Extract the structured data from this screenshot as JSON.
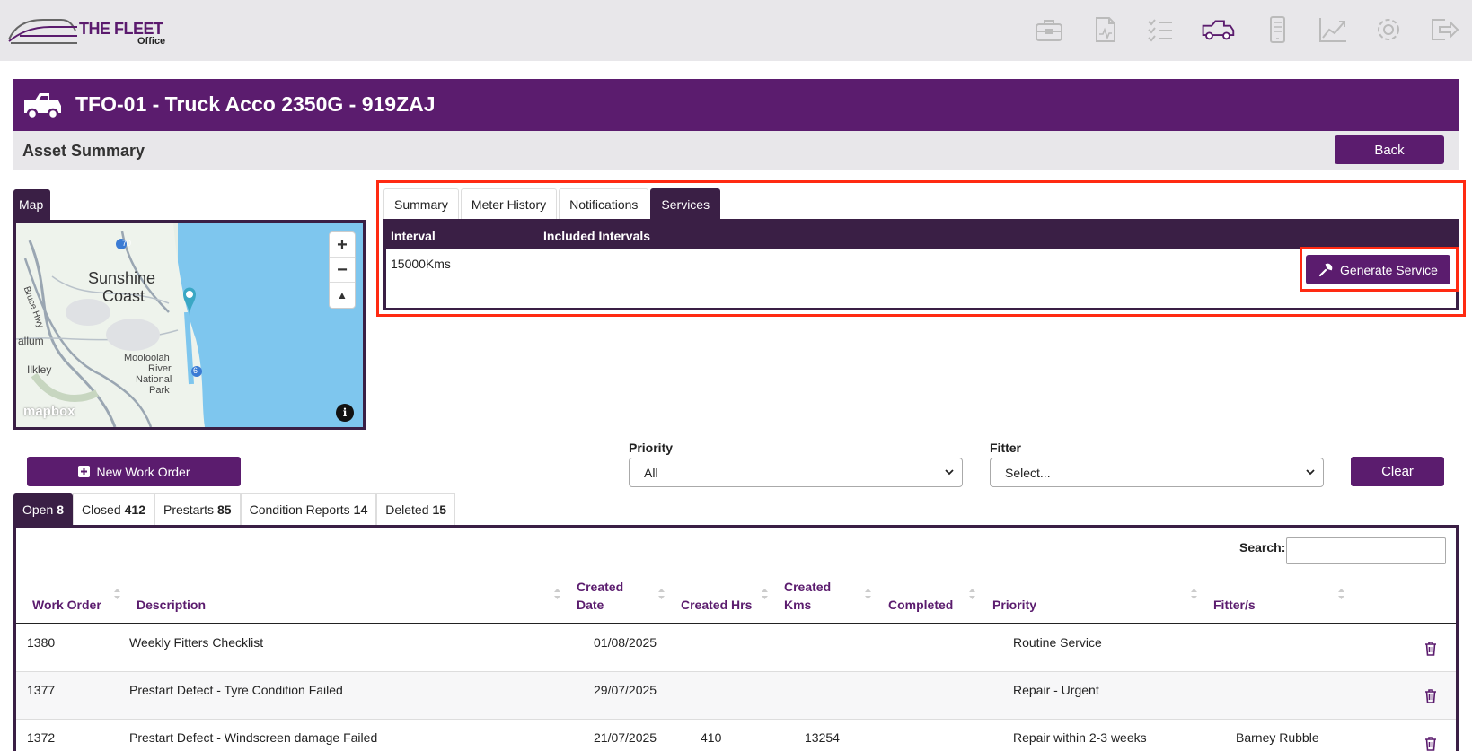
{
  "app": {
    "logo_title": "THE FLEET",
    "logo_subtitle": "Office",
    "accent_color": "#5b1c6e",
    "nav_icons": [
      "toolbox-icon",
      "report-doc-icon",
      "checklist-icon",
      "truck-icon",
      "mobile-icon",
      "chart-icon",
      "gear-icon",
      "logout-icon"
    ]
  },
  "asset": {
    "title": "TFO-01 - Truck Acco 2350G - 919ZAJ",
    "section_title": "Asset Summary",
    "back_label": "Back"
  },
  "map": {
    "tab_label": "Map",
    "labels": {
      "sunshine": "Sunshine",
      "coast": "Coast",
      "mooloolah": "Mooloolah",
      "river": "River",
      "national": "National",
      "park": "Park",
      "ilkley": "Ilkley",
      "allum": "allum",
      "bruce": "Bruce Hwy"
    },
    "road_badges": [
      "70",
      "6"
    ],
    "attribution": "mapbox",
    "zoom_in": "+",
    "zoom_out": "−"
  },
  "services_panel": {
    "tabs": [
      "Summary",
      "Meter History",
      "Notifications",
      "Services"
    ],
    "active_tab": "Services",
    "headers": {
      "interval": "Interval",
      "included": "Included Intervals"
    },
    "rows": [
      {
        "interval": "15000Kms",
        "included": ""
      }
    ],
    "generate_label": "Generate Service"
  },
  "filters": {
    "new_work_order_label": "New Work Order",
    "priority_label": "Priority",
    "priority_value": "All",
    "fitter_label": "Fitter",
    "fitter_value": "Select...",
    "clear_label": "Clear"
  },
  "work_order_tabs": [
    {
      "label": "Open",
      "count": "8"
    },
    {
      "label": "Closed",
      "count": "412"
    },
    {
      "label": "Prestarts",
      "count": "85"
    },
    {
      "label": "Condition Reports",
      "count": "14"
    },
    {
      "label": "Deleted",
      "count": "15"
    }
  ],
  "table": {
    "search_label": "Search:",
    "columns": {
      "work_order": "Work Order",
      "description": "Description",
      "created_date_1": "Created",
      "created_date_2": "Date",
      "created_hrs": "Created Hrs",
      "created_kms_1": "Created",
      "created_kms_2": "Kms",
      "completed": "Completed",
      "priority": "Priority",
      "fitters": "Fitter/s"
    },
    "rows": [
      {
        "wo": "1380",
        "description": "Weekly Fitters Checklist",
        "date": "01/08/2025",
        "hrs": "",
        "kms": "",
        "completed": "",
        "priority": "Routine Service",
        "fitter": ""
      },
      {
        "wo": "1377",
        "description": "Prestart Defect - Tyre Condition Failed",
        "date": "29/07/2025",
        "hrs": "",
        "kms": "",
        "completed": "",
        "priority": "Repair - Urgent",
        "fitter": ""
      },
      {
        "wo": "1372",
        "description": "Prestart Defect - Windscreen damage Failed",
        "date": "21/07/2025",
        "hrs": "410",
        "kms": "13254",
        "completed": "",
        "priority": "Repair within 2-3 weeks",
        "fitter": "Barney Rubble"
      }
    ]
  }
}
